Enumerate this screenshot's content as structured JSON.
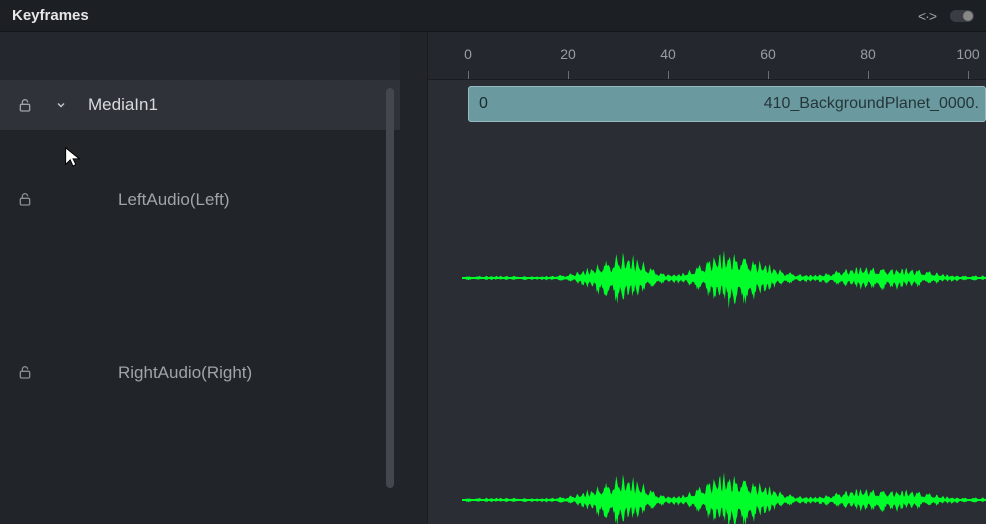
{
  "panel": {
    "title": "Keyframes"
  },
  "ruler": {
    "ticks": [
      0,
      20,
      40,
      60,
      80,
      100
    ]
  },
  "tracks": [
    {
      "label": "MediaIn1",
      "expandable": true,
      "selected": true
    },
    {
      "label": "LeftAudio(Left)",
      "kind": "audio"
    },
    {
      "label": "RightAudio(Right)",
      "kind": "audio"
    }
  ],
  "clip": {
    "start_frame": "0",
    "name": "410_BackgroundPlanet_0000."
  },
  "colors": {
    "waveform": "#00ff2a",
    "clip_bg": "#6a9aa0"
  }
}
